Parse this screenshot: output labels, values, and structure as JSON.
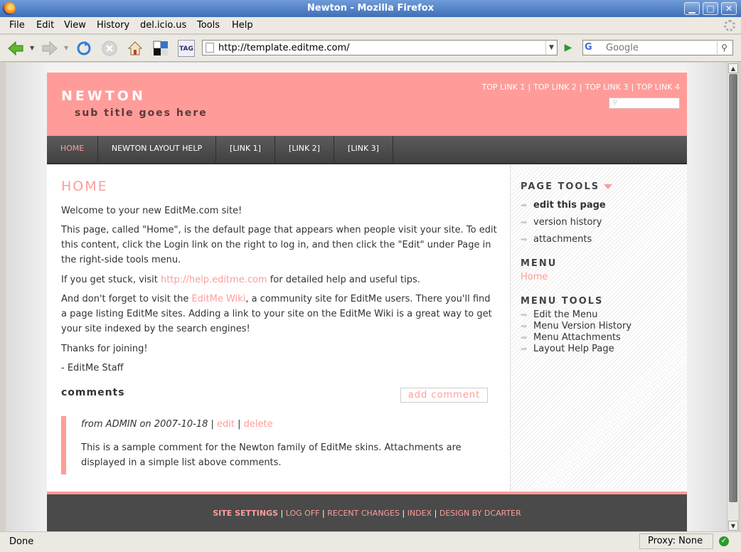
{
  "window": {
    "title": "Newton - Mozilla Firefox",
    "minimize": "▁",
    "maximize": "□",
    "close": "✕"
  },
  "menubar": {
    "items": [
      {
        "label": "File"
      },
      {
        "label": "Edit"
      },
      {
        "label": "View"
      },
      {
        "label": "History"
      },
      {
        "label": "del.icio.us"
      },
      {
        "label": "Tools"
      },
      {
        "label": "Help"
      }
    ]
  },
  "toolbar": {
    "url": "http://template.editme.com/",
    "search_placeholder": "Google",
    "search_engine": "G",
    "tag_label": "TAG"
  },
  "site": {
    "title": "NEWTON",
    "subtitle": "sub title goes here",
    "top_links": [
      "TOP LINK 1",
      "TOP LINK 2",
      "TOP LINK 3",
      "TOP LINK 4"
    ],
    "nav": [
      "HOME",
      "NEWTON LAYOUT HELP",
      "[LINK 1]",
      "[LINK 2]",
      "[LINK 3]"
    ],
    "accent_color": "#ff9c99"
  },
  "content": {
    "heading": "HOME",
    "p1": "Welcome to your new EditMe.com site!",
    "p2": "This page, called \"Home\", is the default page that appears when people visit your site. To edit this content, click the Login link on the right to log in, and then click the \"Edit\" under Page in the right-side tools menu.",
    "p3_before": "If you get stuck, visit ",
    "p3_link": "http://help.editme.com",
    "p3_after": " for detailed help and useful tips.",
    "p4_before": "And don't forget to visit the ",
    "p4_link": "EditMe Wiki",
    "p4_after": ", a community site for EditMe users. There you'll find a page listing EditMe sites. Adding a link to your site on the EditMe Wiki is a great way to get your site indexed by the search engines!",
    "p5": "Thanks for joining!",
    "p6": "- EditMe Staff",
    "comments_title": "comments",
    "add_comment": "add comment",
    "comment_meta": "from ADMIN on 2007-10-18",
    "comment_edit": "edit",
    "comment_delete": "delete",
    "comment_body": "This is a sample comment for the Newton family of EditMe skins. Attachments are displayed in a simple list above comments."
  },
  "sidebar": {
    "page_tools_title": "PAGE TOOLS",
    "page_tools": [
      "edit this page",
      "version history",
      "attachments"
    ],
    "menu_title": "MENU",
    "menu_items": [
      "Home"
    ],
    "menu_tools_title": "MENU TOOLS",
    "menu_tools": [
      "Edit the Menu",
      "Menu Version History",
      "Menu Attachments",
      "Layout Help Page"
    ]
  },
  "footer": {
    "links": [
      "SITE SETTINGS",
      "LOG OFF",
      "RECENT CHANGES",
      "INDEX",
      "DESIGN BY DCARTER"
    ]
  },
  "statusbar": {
    "status": "Done",
    "proxy": "Proxy: None",
    "ok": "✓"
  }
}
